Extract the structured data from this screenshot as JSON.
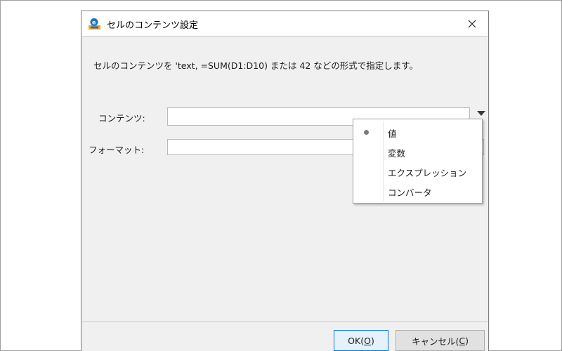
{
  "dialog": {
    "title": "セルのコンテンツ設定",
    "description": "セルのコンテンツを 'text, =SUM(D1:D10) または 42 などの形式で指定します。",
    "contents_label": "コンテンツ:",
    "format_label": "フォーマット:",
    "contents_value": "",
    "format_value": ""
  },
  "menu": {
    "items": [
      {
        "label": "値",
        "selected": true
      },
      {
        "label": "変数",
        "selected": false
      },
      {
        "label": "エクスプレッション",
        "selected": false
      },
      {
        "label": "コンバータ",
        "selected": false
      }
    ]
  },
  "buttons": {
    "ok_label": "OK(",
    "ok_mnemonic": "O",
    "ok_suffix": ")",
    "cancel_label": "キャンセル(",
    "cancel_mnemonic": "C",
    "cancel_suffix": ")"
  },
  "icons": {
    "app": "app-logo-icon",
    "close": "close-icon",
    "dropdown": "dropdown-arrow-icon",
    "bullet": "radio-bullet-icon"
  },
  "colors": {
    "accent": "#0078d7",
    "dialog_bg": "#f0f0f0"
  }
}
